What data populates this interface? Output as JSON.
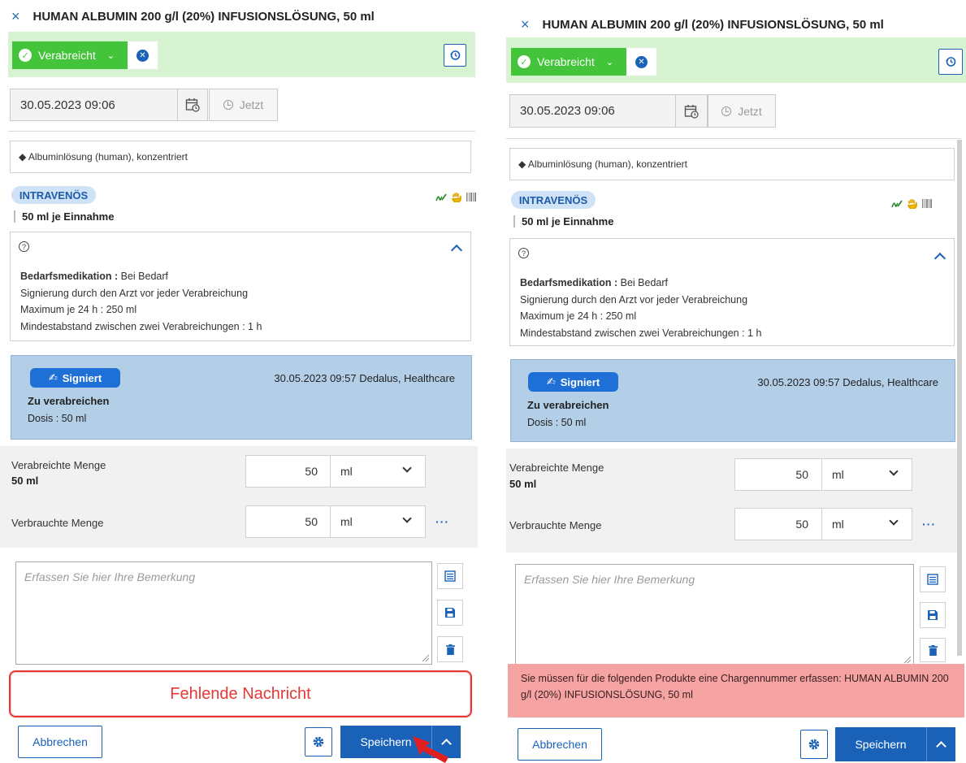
{
  "title": "HUMAN ALBUMIN 200 g/l (20%) INFUSIONSLÖSUNG, 50 ml",
  "status": {
    "label": "Verabreicht"
  },
  "date": {
    "value": "30.05.2023 09:06",
    "now_label": "Jetzt"
  },
  "product": {
    "name": "◆ Albuminlösung (human), konzentriert"
  },
  "route": {
    "label": "INTRAVENÖS"
  },
  "dose": {
    "label": "50 ml je Einnahme"
  },
  "info": {
    "lines": [
      {
        "bold": "Bedarfsmedikation :",
        "text": " Bei Bedarf"
      },
      {
        "bold": "",
        "text": "Signierung durch den Arzt vor jeder Verabreichung"
      },
      {
        "bold": "",
        "text": "Maximum je 24 h : 250 ml"
      },
      {
        "bold": "",
        "text": "Mindestabstand zwischen zwei Verabreichungen : 1 h"
      }
    ]
  },
  "signature": {
    "badge": "Signiert",
    "meta": "30.05.2023 09:57 Dedalus, Healthcare",
    "title": "Zu verabreichen",
    "dose": "Dosis : 50 ml"
  },
  "administered": {
    "label": "Verabreichte Menge",
    "sub": "50 ml",
    "value": "50",
    "unit": "ml"
  },
  "consumed": {
    "label": "Verbrauchte Menge",
    "value": "50",
    "unit": "ml",
    "more": "···"
  },
  "remark": {
    "placeholder": "Erfassen Sie hier Ihre Bemerkung"
  },
  "annotation": {
    "text": "Fehlende Nachricht"
  },
  "error": {
    "text": "Sie müssen für die folgenden Produkte eine Chargennummer erfassen: HUMAN ALBUMIN 200 g/l (20%) INFUSIONSLÖSUNG, 50 ml"
  },
  "footer": {
    "cancel": "Abbrechen",
    "save": "Speichern"
  },
  "colors": {
    "green": "#44c43a",
    "blue": "#1a62b8",
    "error_bg": "#f5a3a3",
    "annotation_red": "#e53935",
    "signed_bg": "#b3cfe7"
  }
}
